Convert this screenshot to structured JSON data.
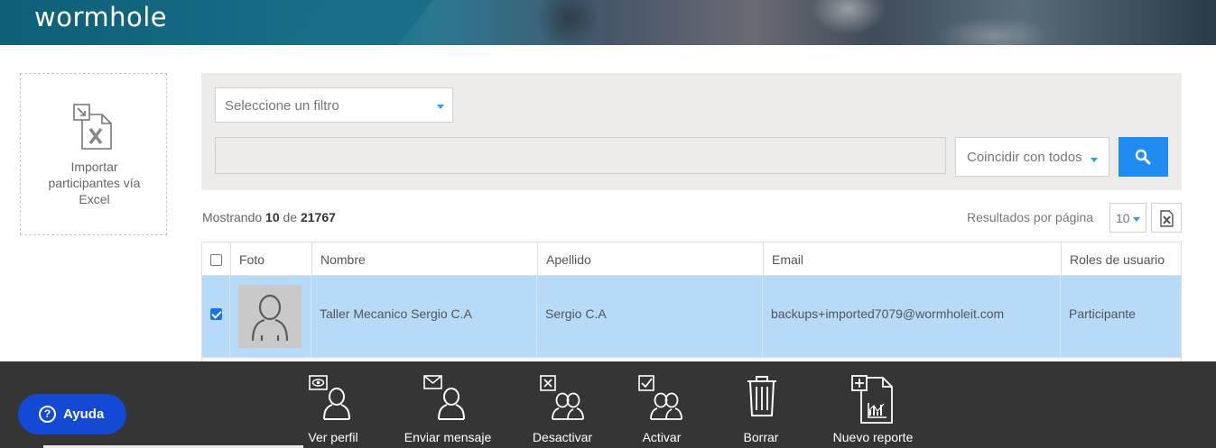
{
  "header": {
    "logo": "wormhole"
  },
  "import": {
    "label": "Importar participantes vía Excel",
    "icon": "excel-import-icon"
  },
  "filters": {
    "filter_placeholder": "Seleccione un filtro",
    "search_value": "",
    "match_mode": "Coincidir con todos",
    "search_icon": "search-icon"
  },
  "summary": {
    "prefix": "Mostrando",
    "shown": "10",
    "of": "de",
    "total": "21767"
  },
  "pagination": {
    "per_page_label": "Resultados por página",
    "per_page": "10",
    "export_icon": "excel-export-icon"
  },
  "table": {
    "columns": [
      "Foto",
      "Nombre",
      "Apellido",
      "Email",
      "Roles de usuario"
    ],
    "rows": [
      {
        "selected": true,
        "photo": "avatar-placeholder-icon",
        "nombre": "Taller Mecanico Sergio C.A",
        "apellido": "Sergio C.A",
        "email": "backups+imported7079@wormholeit.com",
        "rol": "Participante"
      }
    ]
  },
  "toolbar": {
    "actions": [
      {
        "label": "Ver perfil",
        "icon": "view-profile-icon"
      },
      {
        "label": "Enviar mensaje",
        "icon": "send-message-icon"
      },
      {
        "label": "Desactivar",
        "icon": "deactivate-users-icon"
      },
      {
        "label": "Activar",
        "icon": "activate-users-icon"
      },
      {
        "label": "Borrar",
        "icon": "trash-icon"
      },
      {
        "label": "Nuevo reporte",
        "icon": "new-report-icon"
      }
    ]
  },
  "help": {
    "label": "Ayuda",
    "icon": "help-icon"
  },
  "colors": {
    "accent": "#1e8cf0",
    "selected_row": "#b7daf9",
    "toolbar": "#353535",
    "help": "#1449d6",
    "header": "#0e5f78"
  }
}
